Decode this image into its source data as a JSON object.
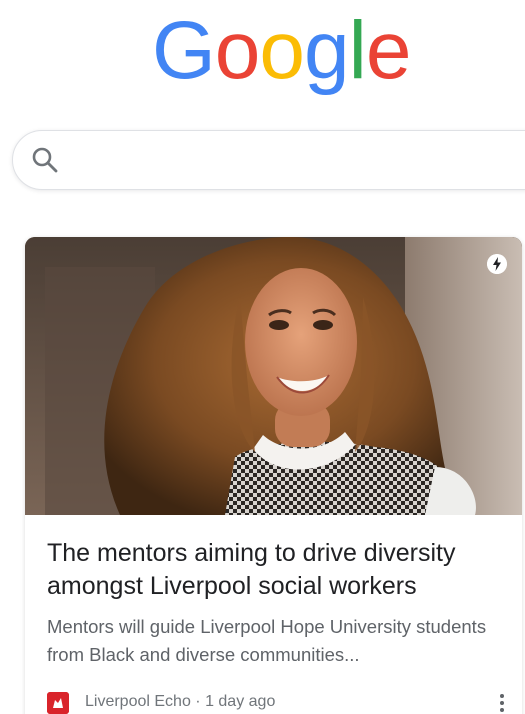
{
  "logo": {
    "letters": [
      {
        "char": "G",
        "color": "#4285F4"
      },
      {
        "char": "o",
        "color": "#EA4335"
      },
      {
        "char": "o",
        "color": "#FBBC05"
      },
      {
        "char": "g",
        "color": "#4285F4"
      },
      {
        "char": "l",
        "color": "#34A853"
      },
      {
        "char": "e",
        "color": "#EA4335"
      }
    ]
  },
  "search": {
    "placeholder": "",
    "icon": "search-icon"
  },
  "card": {
    "headline": "The mentors aiming to drive diversity amongst Liverpool social workers",
    "snippet": "Mentors will guide Liverpool Hope University students from Black and diverse communities...",
    "source": "Liverpool Echo",
    "separator": " · ",
    "age": "1 day ago",
    "badge_icon": "amp-lightning-icon",
    "menu_icon": "more-vert-icon",
    "favicon_color": "#d9242b"
  }
}
